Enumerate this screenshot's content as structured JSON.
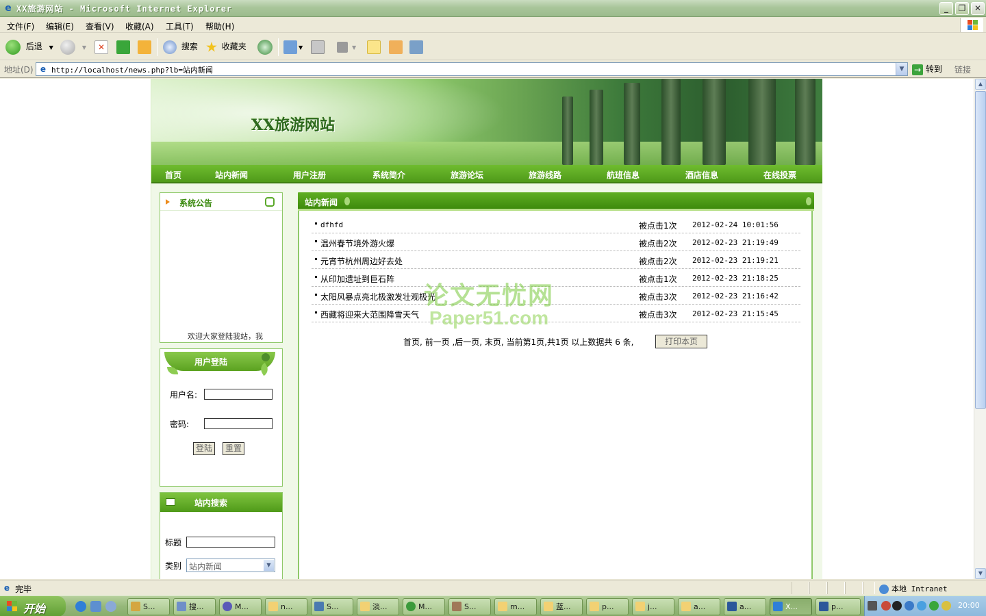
{
  "window": {
    "title": "XX旅游网站 - Microsoft Internet Explorer",
    "minimize": "_",
    "restore": "❐",
    "close": "✕"
  },
  "menu": [
    "文件(F)",
    "编辑(E)",
    "查看(V)",
    "收藏(A)",
    "工具(T)",
    "帮助(H)"
  ],
  "toolbar": {
    "back_label": "后退",
    "search_label": "搜索",
    "favorites_label": "收藏夹"
  },
  "address": {
    "label": "地址(D)",
    "url": "http://localhost/news.php?lb=站内新闻",
    "go_label": "转到",
    "links_label": "链接"
  },
  "site": {
    "title": "XX旅游网站",
    "nav": [
      "首页",
      "站内新闻",
      "用户注册",
      "系统简介",
      "旅游论坛",
      "旅游线路",
      "航班信息",
      "酒店信息",
      "在线投票"
    ],
    "notice": {
      "title": "系统公告",
      "marquee": "欢迎大家登陆我站，我"
    },
    "login": {
      "title": "用户登陆",
      "username_label": "用户名:",
      "password_label": "密码:",
      "login_button": "登陆",
      "reset_button": "重置"
    },
    "search": {
      "title": "站内搜索",
      "title_label": "标题",
      "category_label": "类别",
      "category_value": "站内新闻"
    },
    "news": {
      "header": "站内新闻",
      "rows": [
        {
          "title": "dfhfd",
          "clicks": "被点击1次",
          "date": "2012-02-24 10:01:56"
        },
        {
          "title": "温州春节境外游火爆",
          "clicks": "被点击2次",
          "date": "2012-02-23 21:19:49"
        },
        {
          "title": "元宵节杭州周边好去处",
          "clicks": "被点击2次",
          "date": "2012-02-23 21:19:21"
        },
        {
          "title": "从印加遗址到巨石阵",
          "clicks": "被点击1次",
          "date": "2012-02-23 21:18:25"
        },
        {
          "title": "太阳风暴点亮北极激发壮观极光",
          "clicks": "被点击3次",
          "date": "2012-02-23 21:16:42"
        },
        {
          "title": "西藏将迎来大范围降雪天气",
          "clicks": "被点击3次",
          "date": "2012-02-23 21:15:45"
        }
      ],
      "pager": "首页, 前一页 ,后一页, 末页, 当前第1页,共1页 以上数据共 6 条,",
      "print_button": "打印本页"
    },
    "watermark": {
      "line1": "论文无忧网",
      "line2": "Paper51.com"
    }
  },
  "status": {
    "text": "完毕",
    "zone": "本地 Intranet"
  },
  "taskbar": {
    "start": "开始",
    "tasks": [
      "S...",
      "搜...",
      "M...",
      "n...",
      "S...",
      "淡...",
      "M...",
      "S...",
      "m...",
      "蓝...",
      "p...",
      "j...",
      "a...",
      "a...",
      "X...",
      "p..."
    ],
    "clock": "20:00"
  },
  "colors": {
    "nav_green": "#4f9a19",
    "panel_border": "#8fc96a",
    "heading_green": "#3b8a0f"
  }
}
